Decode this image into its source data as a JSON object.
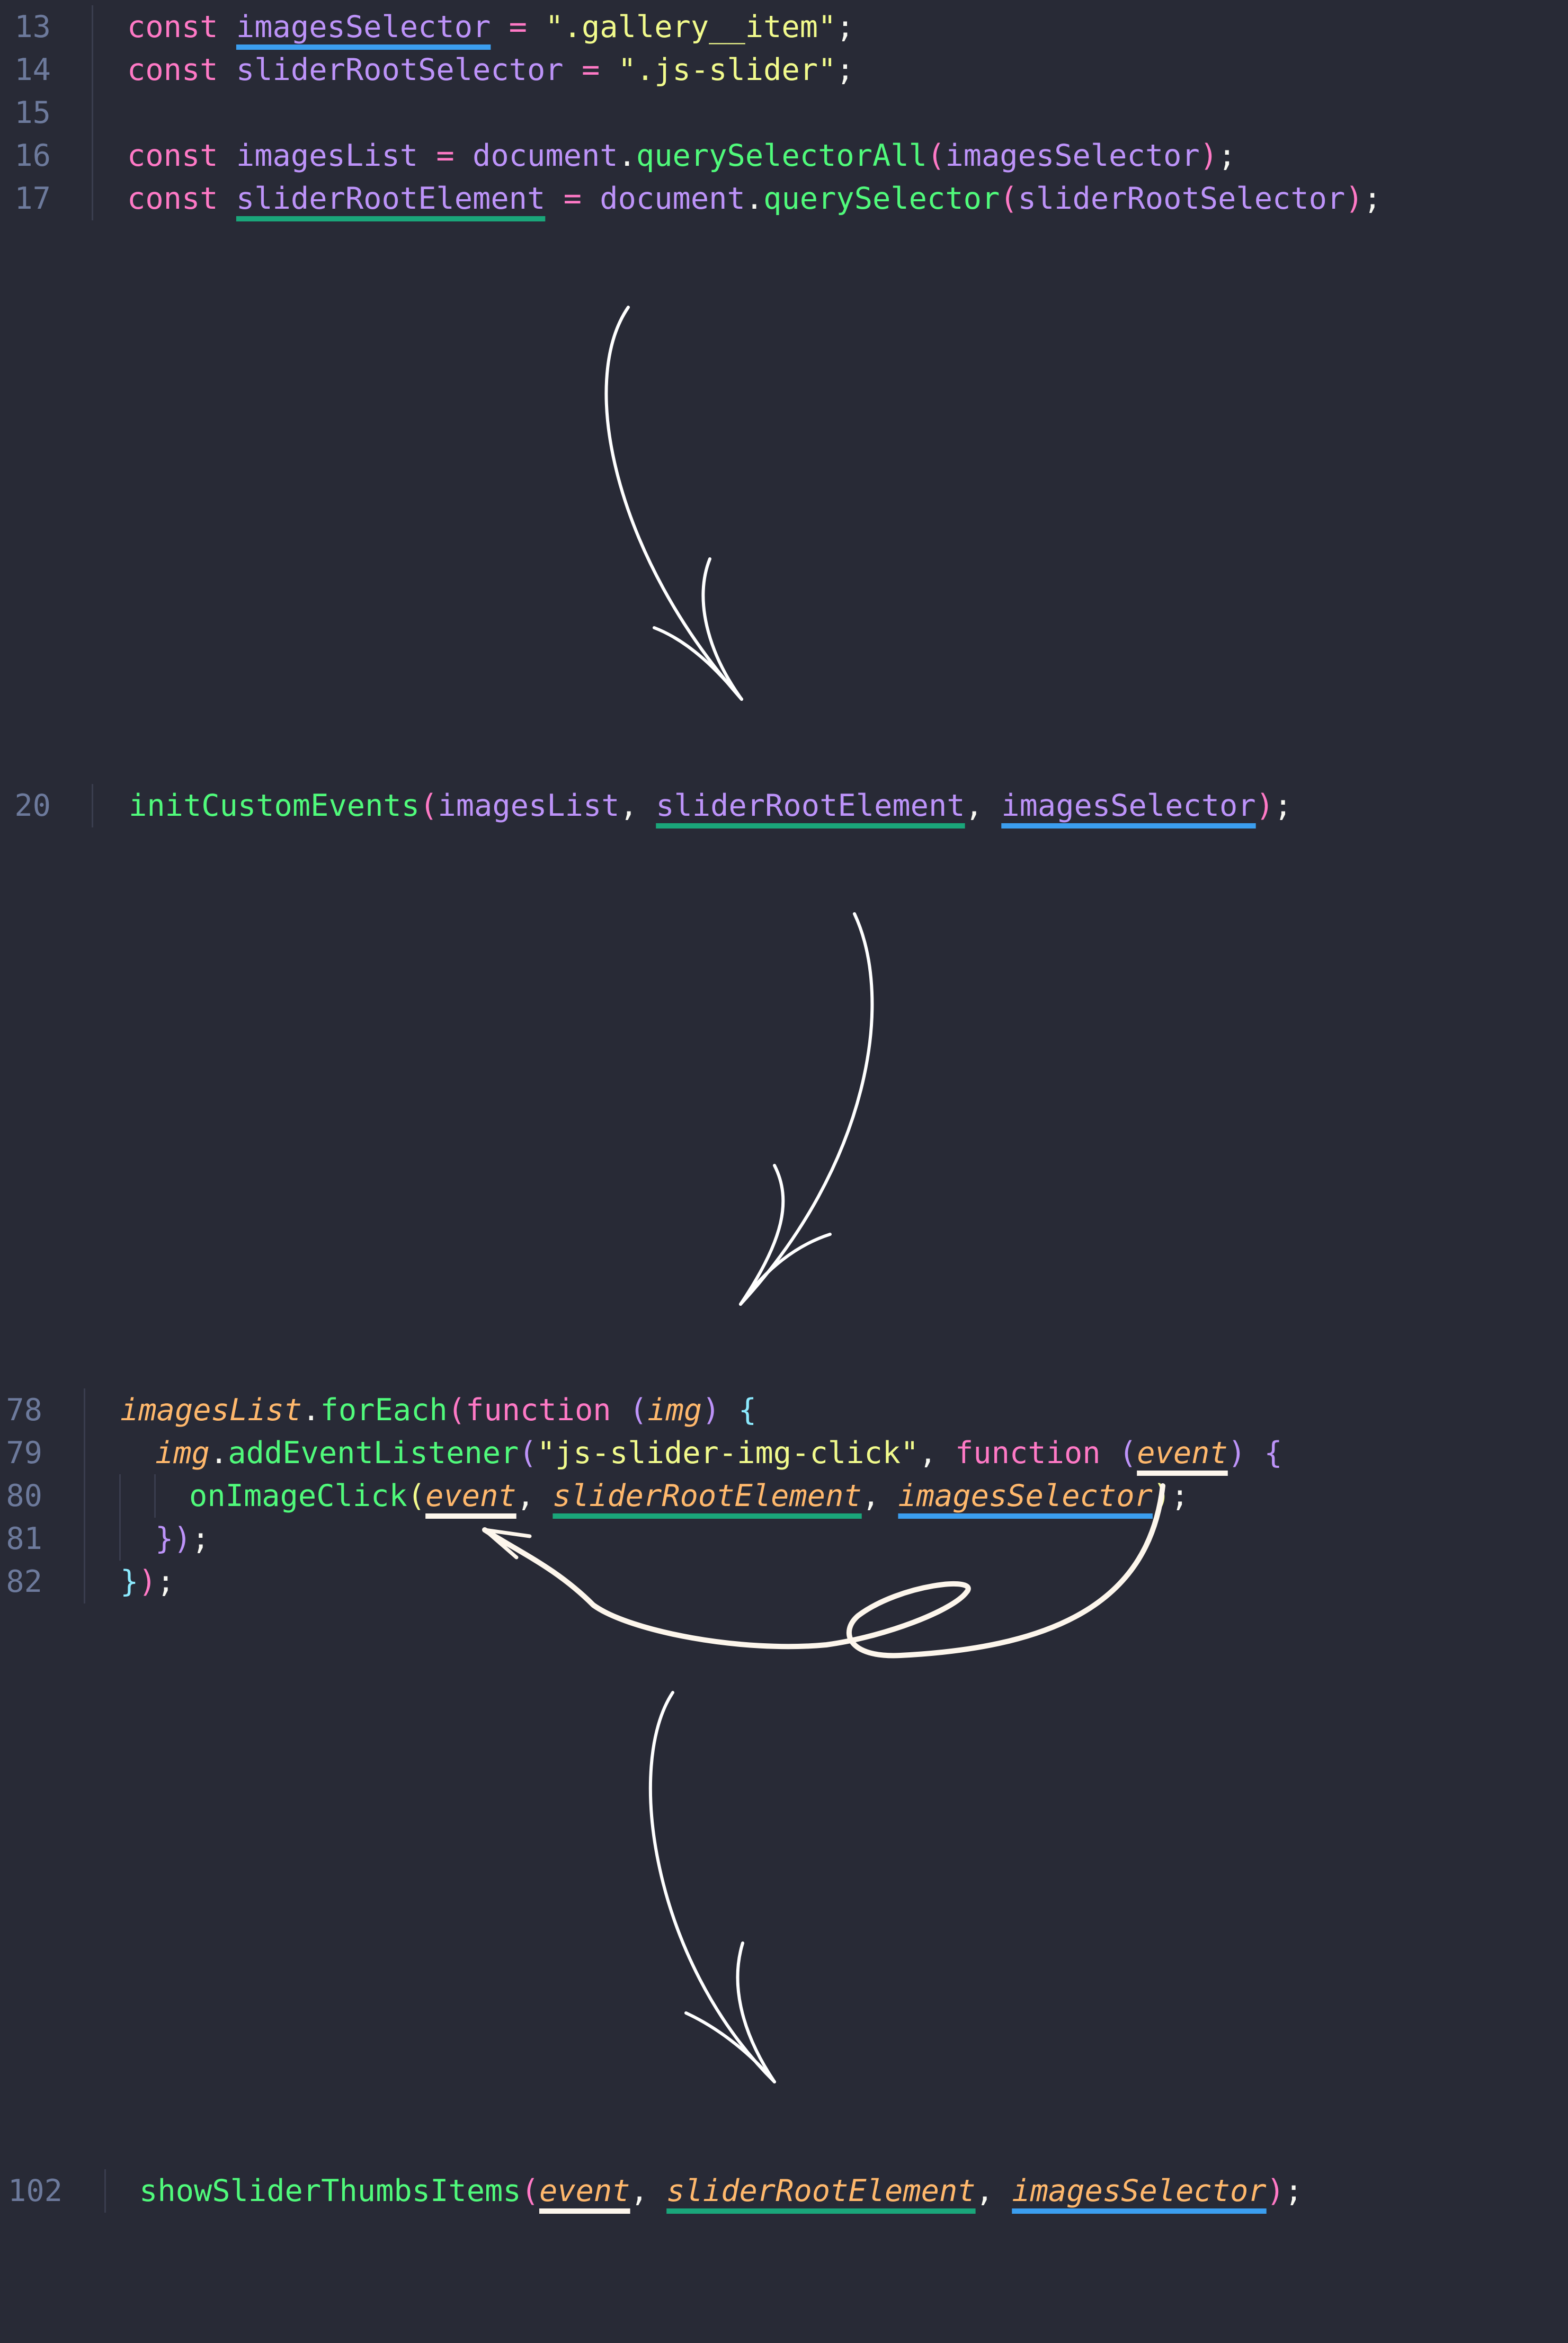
{
  "block1": {
    "l13": {
      "num": "13",
      "kw": "const",
      "name": "imagesSelector",
      "eq": " = ",
      "str": "\".gallery__item\"",
      "semi": ";"
    },
    "l14": {
      "num": "14",
      "kw": "const",
      "name": "sliderRootSelector",
      "eq": " = ",
      "str": "\".js-slider\"",
      "semi": ";"
    },
    "l15": {
      "num": "15"
    },
    "l16": {
      "num": "16",
      "kw": "const",
      "name": "imagesList",
      "eq": " = ",
      "obj": "document",
      "dot": ".",
      "fn": "querySelectorAll",
      "open": "(",
      "arg": "imagesSelector",
      "close": ")",
      "semi": ";"
    },
    "l17": {
      "num": "17",
      "kw": "const",
      "name": "sliderRootElement",
      "eq": " = ",
      "obj": "document",
      "dot": ".",
      "fn": "querySelector",
      "open": "(",
      "arg": "sliderRootSelector",
      "close": ")",
      "semi": ";"
    }
  },
  "block2": {
    "l20": {
      "num": "20",
      "fn": "initCustomEvents",
      "open": "(",
      "a1": "imagesList",
      "c1": ", ",
      "a2": "sliderRootElement",
      "c2": ", ",
      "a3": "imagesSelector",
      "close": ")",
      "semi": ";"
    }
  },
  "block3": {
    "l78": {
      "num": "78",
      "obj": "imagesList",
      "dot": ".",
      "fn": "forEach",
      "open": "(",
      "kw": "function",
      "sp": " ",
      "popen": "(",
      "param": "img",
      "pclose": ")",
      "brace": " {"
    },
    "l79": {
      "num": "79",
      "obj": "img",
      "dot": ".",
      "fn": "addEventListener",
      "open": "(",
      "str": "\"js-slider-img-click\"",
      "comma": ", ",
      "kw": "function",
      "sp": " ",
      "popen": "(",
      "param": "event",
      "pclose": ")",
      "brace": " {"
    },
    "l80": {
      "num": "80",
      "fn": "onImageClick",
      "open": "(",
      "a1": "event",
      "c1": ", ",
      "a2": "sliderRootElement",
      "c2": ", ",
      "a3": "imagesSelector",
      "close": ")",
      "semi": ";"
    },
    "l81": {
      "num": "81",
      "close1": "}",
      "close2": ")",
      "semi": ";"
    },
    "l82": {
      "num": "82",
      "close1": "}",
      "close2": ")",
      "semi": ";"
    }
  },
  "block4": {
    "l102": {
      "num": "102",
      "fn": "showSliderThumbsItems",
      "open": "(",
      "a1": "event",
      "c1": ", ",
      "a2": "sliderRootElement",
      "c2": ", ",
      "a3": "imagesSelector",
      "close": ")",
      "semi": ";"
    }
  },
  "annotations": {
    "arrows": [
      "hand-drawn-arrow-down",
      "hand-drawn-arrow-down",
      "curved-loop-arrow-to-event",
      "hand-drawn-arrow-down"
    ],
    "underline_colors": {
      "imagesSelector": "#3b9eef",
      "sliderRootElement": "#1aa67a",
      "event": "#fdf6ec"
    }
  }
}
